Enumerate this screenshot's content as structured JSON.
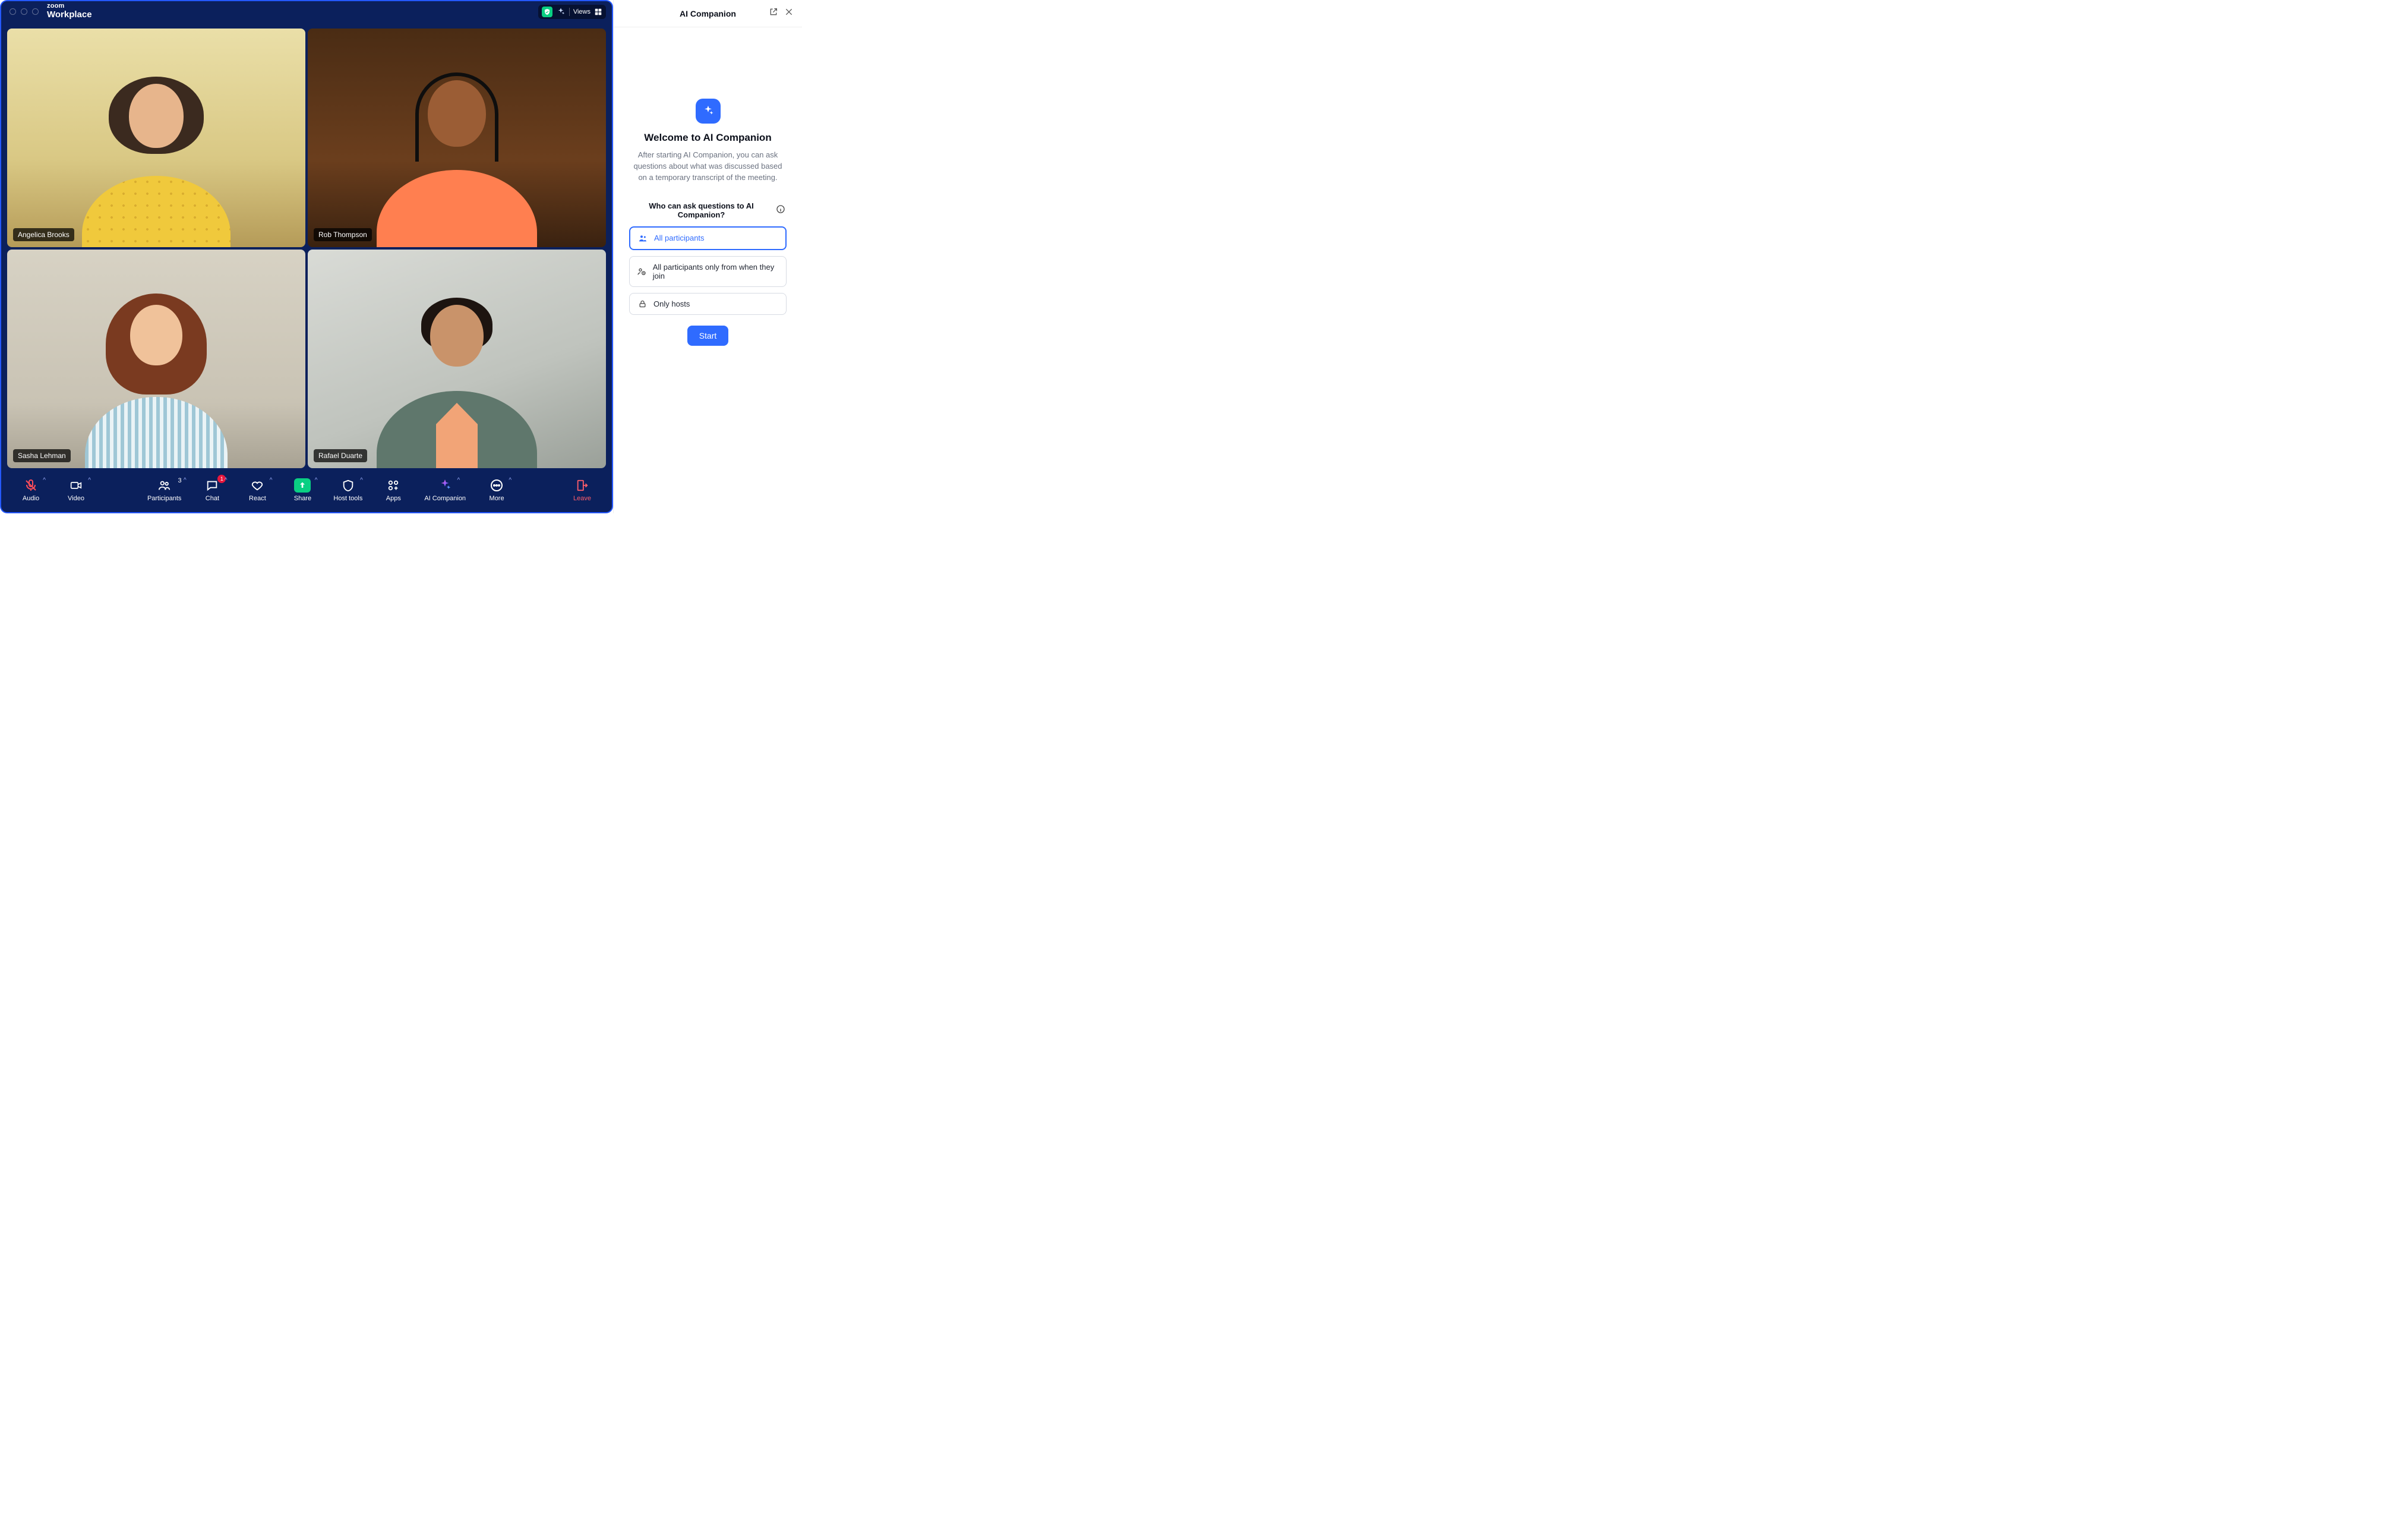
{
  "brand": {
    "top": "zoom",
    "bottom": "Workplace"
  },
  "title_right": {
    "views_label": "Views"
  },
  "participants": [
    {
      "name": "Angelica Brooks"
    },
    {
      "name": "Rob Thompson"
    },
    {
      "name": "Sasha Lehman"
    },
    {
      "name": "Rafael Duarte"
    }
  ],
  "toolbar": {
    "audio": "Audio",
    "video": "Video",
    "participants": "Participants",
    "participants_count": "3",
    "chat": "Chat",
    "chat_badge": "1",
    "react": "React",
    "share": "Share",
    "host_tools": "Host tools",
    "apps": "Apps",
    "ai_companion": "AI Companion",
    "more": "More",
    "leave": "Leave"
  },
  "panel": {
    "header": "AI Companion",
    "welcome_title": "Welcome to AI Companion",
    "welcome_desc": "After starting AI Companion, you can ask questions about what was discussed based on a temporary transcript of the meeting.",
    "question": "Who can ask questions to AI Companion?",
    "options": [
      {
        "label": "All participants"
      },
      {
        "label": "All participants only from when they join"
      },
      {
        "label": "Only hosts"
      }
    ],
    "start": "Start"
  }
}
